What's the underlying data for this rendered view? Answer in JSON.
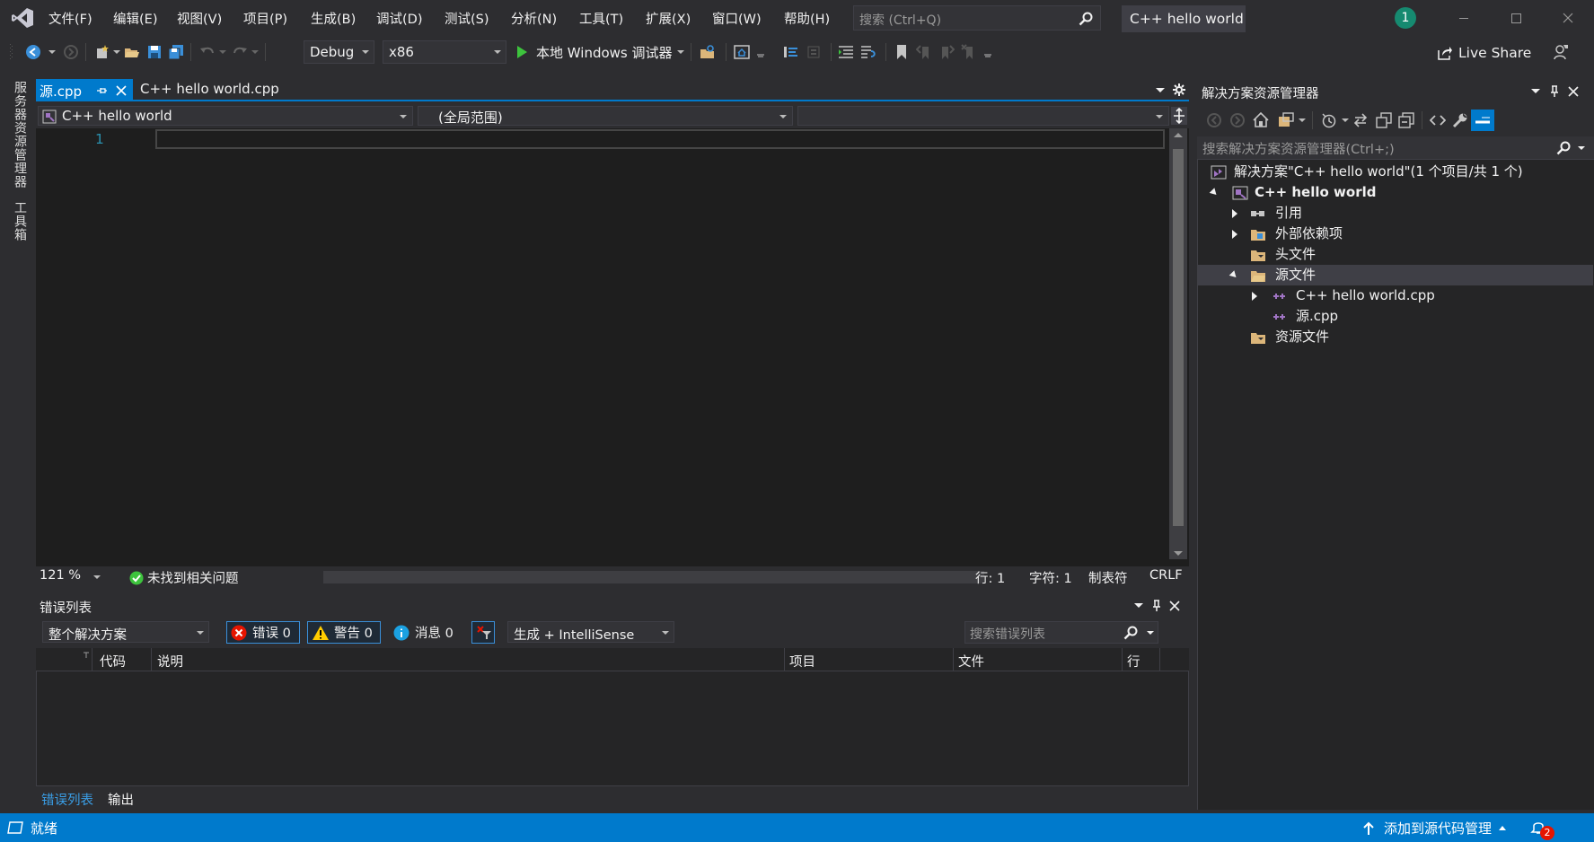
{
  "titlebar": {
    "menu": [
      "文件(F)",
      "编辑(E)",
      "视图(V)",
      "项目(P)",
      "生成(B)",
      "调试(D)",
      "测试(S)",
      "分析(N)",
      "工具(T)",
      "扩展(X)",
      "窗口(W)",
      "帮助(H)"
    ],
    "search_placeholder": "搜索 (Ctrl+Q)",
    "solution_title": "C++ hello world",
    "user_badge": "1"
  },
  "toolbar": {
    "config": "Debug",
    "platform": "x86",
    "run_label": "本地 Windows 调试器",
    "live_share": "Live Share"
  },
  "sidetabs": [
    "服务器资源管理器",
    "工具箱"
  ],
  "editor": {
    "tabs": [
      {
        "label": "源.cpp",
        "active": true
      },
      {
        "label": "C++ hello world.cpp",
        "active": false
      }
    ],
    "nav": {
      "project": "C++ hello world",
      "scope": "(全局范围)",
      "member": ""
    },
    "line_numbers": [
      "1"
    ],
    "status": {
      "zoom": "121 %",
      "issues": "未找到相关问题",
      "line": "行: 1",
      "char": "字符: 1",
      "tabs": "制表符",
      "eol": "CRLF"
    }
  },
  "error_list": {
    "title": "错误列表",
    "scope": "整个解决方案",
    "errors": "错误 0",
    "warnings": "警告 0",
    "messages": "消息 0",
    "source": "生成 + IntelliSense",
    "search_placeholder": "搜索错误列表",
    "columns": [
      "代码",
      "说明",
      "项目",
      "文件",
      "行"
    ],
    "bottom_tabs": [
      "错误列表",
      "输出"
    ]
  },
  "solution_explorer": {
    "title": "解决方案资源管理器",
    "search_placeholder": "搜索解决方案资源管理器(Ctrl+;)",
    "tree": {
      "solution": "解决方案\"C++ hello world\"(1 个项目/共 1 个)",
      "project": "C++ hello world",
      "references": "引用",
      "external_deps": "外部依赖项",
      "header_files": "头文件",
      "source_files": "源文件",
      "file1": "C++ hello world.cpp",
      "file2": "源.cpp",
      "resource_files": "资源文件"
    }
  },
  "statusbar": {
    "ready": "就绪",
    "source_control": "添加到源代码管理",
    "notifications": "2"
  },
  "colors": {
    "accent": "#007acc",
    "background": "#2d2d30",
    "editor": "#1e1e1e",
    "line_number": "#2b91af",
    "error": "#e51400",
    "warning": "#ffcc00",
    "info": "#1ba1e2"
  }
}
